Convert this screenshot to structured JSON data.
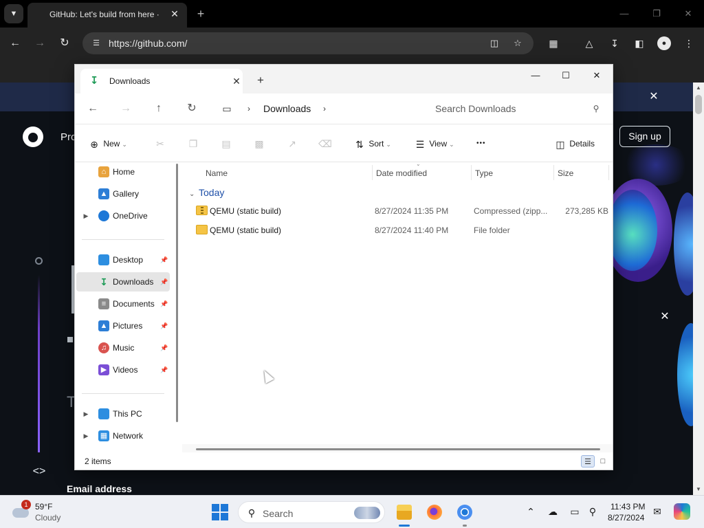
{
  "browser": {
    "tab_title": "GitHub: Let's build from here ·",
    "tab_close": "✕",
    "new_tab": "+",
    "url": "https://github.com/"
  },
  "github_page": {
    "nav_text": "Pro",
    "signup_label": "Sign up",
    "email_label": "Email address",
    "left_char": "T"
  },
  "explorer": {
    "tab_label": "Downloads",
    "breadcrumb": "Downloads",
    "search_placeholder": "Search Downloads",
    "commands": {
      "new": "New",
      "sort": "Sort",
      "view": "View",
      "more": "•••",
      "details": "Details"
    },
    "sidebar": {
      "items": [
        {
          "label": "Home",
          "icon": "home-icon",
          "color": "#e8a33d"
        },
        {
          "label": "Gallery",
          "icon": "gallery-icon",
          "color": "#2d7ed6"
        },
        {
          "label": "OneDrive",
          "icon": "cloud-icon",
          "color": "#1e78d7",
          "expandable": true
        },
        {
          "label": "Desktop",
          "icon": "desktop-icon",
          "color": "#2d8ee0",
          "pinned": true
        },
        {
          "label": "Downloads",
          "icon": "download-icon",
          "color": "#1e9b57",
          "pinned": true,
          "selected": true
        },
        {
          "label": "Documents",
          "icon": "document-icon",
          "color": "#8a8a8a",
          "pinned": true
        },
        {
          "label": "Pictures",
          "icon": "pictures-icon",
          "color": "#2d7ed6",
          "pinned": true
        },
        {
          "label": "Music",
          "icon": "music-icon",
          "color": "#d9534f",
          "pinned": true
        },
        {
          "label": "Videos",
          "icon": "video-icon",
          "color": "#7b4fd6",
          "pinned": true
        },
        {
          "label": "This PC",
          "icon": "pc-icon",
          "color": "#2d8ee0",
          "expandable": true
        },
        {
          "label": "Network",
          "icon": "network-icon",
          "color": "#2d8ee0",
          "expandable": true
        }
      ]
    },
    "columns": {
      "name": "Name",
      "date": "Date modified",
      "type": "Type",
      "size": "Size"
    },
    "group": "Today",
    "files": [
      {
        "name": "QEMU (static build)",
        "date": "8/27/2024 11:35 PM",
        "type": "Compressed (zipp...",
        "size": "273,285 KB",
        "icon": "zip-folder-icon"
      },
      {
        "name": "QEMU (static build)",
        "date": "8/27/2024 11:40 PM",
        "type": "File folder",
        "size": "",
        "icon": "folder-icon"
      }
    ],
    "status": "2 items"
  },
  "taskbar": {
    "weather_temp": "59°F",
    "weather_cond": "Cloudy",
    "weather_badge": "1",
    "search_label": "Search",
    "time": "11:43 PM",
    "date": "8/27/2024"
  },
  "colors": {
    "accent": "#1e78d7",
    "github_bg": "#0d1117",
    "chrome_dark": "#232323"
  }
}
